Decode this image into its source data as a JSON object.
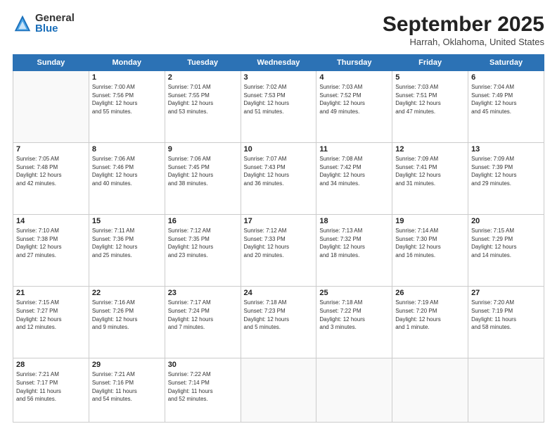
{
  "header": {
    "logo_general": "General",
    "logo_blue": "Blue",
    "month": "September 2025",
    "location": "Harrah, Oklahoma, United States"
  },
  "weekdays": [
    "Sunday",
    "Monday",
    "Tuesday",
    "Wednesday",
    "Thursday",
    "Friday",
    "Saturday"
  ],
  "weeks": [
    [
      {
        "day": "",
        "info": ""
      },
      {
        "day": "1",
        "info": "Sunrise: 7:00 AM\nSunset: 7:56 PM\nDaylight: 12 hours\nand 55 minutes."
      },
      {
        "day": "2",
        "info": "Sunrise: 7:01 AM\nSunset: 7:55 PM\nDaylight: 12 hours\nand 53 minutes."
      },
      {
        "day": "3",
        "info": "Sunrise: 7:02 AM\nSunset: 7:53 PM\nDaylight: 12 hours\nand 51 minutes."
      },
      {
        "day": "4",
        "info": "Sunrise: 7:03 AM\nSunset: 7:52 PM\nDaylight: 12 hours\nand 49 minutes."
      },
      {
        "day": "5",
        "info": "Sunrise: 7:03 AM\nSunset: 7:51 PM\nDaylight: 12 hours\nand 47 minutes."
      },
      {
        "day": "6",
        "info": "Sunrise: 7:04 AM\nSunset: 7:49 PM\nDaylight: 12 hours\nand 45 minutes."
      }
    ],
    [
      {
        "day": "7",
        "info": "Sunrise: 7:05 AM\nSunset: 7:48 PM\nDaylight: 12 hours\nand 42 minutes."
      },
      {
        "day": "8",
        "info": "Sunrise: 7:06 AM\nSunset: 7:46 PM\nDaylight: 12 hours\nand 40 minutes."
      },
      {
        "day": "9",
        "info": "Sunrise: 7:06 AM\nSunset: 7:45 PM\nDaylight: 12 hours\nand 38 minutes."
      },
      {
        "day": "10",
        "info": "Sunrise: 7:07 AM\nSunset: 7:43 PM\nDaylight: 12 hours\nand 36 minutes."
      },
      {
        "day": "11",
        "info": "Sunrise: 7:08 AM\nSunset: 7:42 PM\nDaylight: 12 hours\nand 34 minutes."
      },
      {
        "day": "12",
        "info": "Sunrise: 7:09 AM\nSunset: 7:41 PM\nDaylight: 12 hours\nand 31 minutes."
      },
      {
        "day": "13",
        "info": "Sunrise: 7:09 AM\nSunset: 7:39 PM\nDaylight: 12 hours\nand 29 minutes."
      }
    ],
    [
      {
        "day": "14",
        "info": "Sunrise: 7:10 AM\nSunset: 7:38 PM\nDaylight: 12 hours\nand 27 minutes."
      },
      {
        "day": "15",
        "info": "Sunrise: 7:11 AM\nSunset: 7:36 PM\nDaylight: 12 hours\nand 25 minutes."
      },
      {
        "day": "16",
        "info": "Sunrise: 7:12 AM\nSunset: 7:35 PM\nDaylight: 12 hours\nand 23 minutes."
      },
      {
        "day": "17",
        "info": "Sunrise: 7:12 AM\nSunset: 7:33 PM\nDaylight: 12 hours\nand 20 minutes."
      },
      {
        "day": "18",
        "info": "Sunrise: 7:13 AM\nSunset: 7:32 PM\nDaylight: 12 hours\nand 18 minutes."
      },
      {
        "day": "19",
        "info": "Sunrise: 7:14 AM\nSunset: 7:30 PM\nDaylight: 12 hours\nand 16 minutes."
      },
      {
        "day": "20",
        "info": "Sunrise: 7:15 AM\nSunset: 7:29 PM\nDaylight: 12 hours\nand 14 minutes."
      }
    ],
    [
      {
        "day": "21",
        "info": "Sunrise: 7:15 AM\nSunset: 7:27 PM\nDaylight: 12 hours\nand 12 minutes."
      },
      {
        "day": "22",
        "info": "Sunrise: 7:16 AM\nSunset: 7:26 PM\nDaylight: 12 hours\nand 9 minutes."
      },
      {
        "day": "23",
        "info": "Sunrise: 7:17 AM\nSunset: 7:24 PM\nDaylight: 12 hours\nand 7 minutes."
      },
      {
        "day": "24",
        "info": "Sunrise: 7:18 AM\nSunset: 7:23 PM\nDaylight: 12 hours\nand 5 minutes."
      },
      {
        "day": "25",
        "info": "Sunrise: 7:18 AM\nSunset: 7:22 PM\nDaylight: 12 hours\nand 3 minutes."
      },
      {
        "day": "26",
        "info": "Sunrise: 7:19 AM\nSunset: 7:20 PM\nDaylight: 12 hours\nand 1 minute."
      },
      {
        "day": "27",
        "info": "Sunrise: 7:20 AM\nSunset: 7:19 PM\nDaylight: 11 hours\nand 58 minutes."
      }
    ],
    [
      {
        "day": "28",
        "info": "Sunrise: 7:21 AM\nSunset: 7:17 PM\nDaylight: 11 hours\nand 56 minutes."
      },
      {
        "day": "29",
        "info": "Sunrise: 7:21 AM\nSunset: 7:16 PM\nDaylight: 11 hours\nand 54 minutes."
      },
      {
        "day": "30",
        "info": "Sunrise: 7:22 AM\nSunset: 7:14 PM\nDaylight: 11 hours\nand 52 minutes."
      },
      {
        "day": "",
        "info": ""
      },
      {
        "day": "",
        "info": ""
      },
      {
        "day": "",
        "info": ""
      },
      {
        "day": "",
        "info": ""
      }
    ]
  ]
}
